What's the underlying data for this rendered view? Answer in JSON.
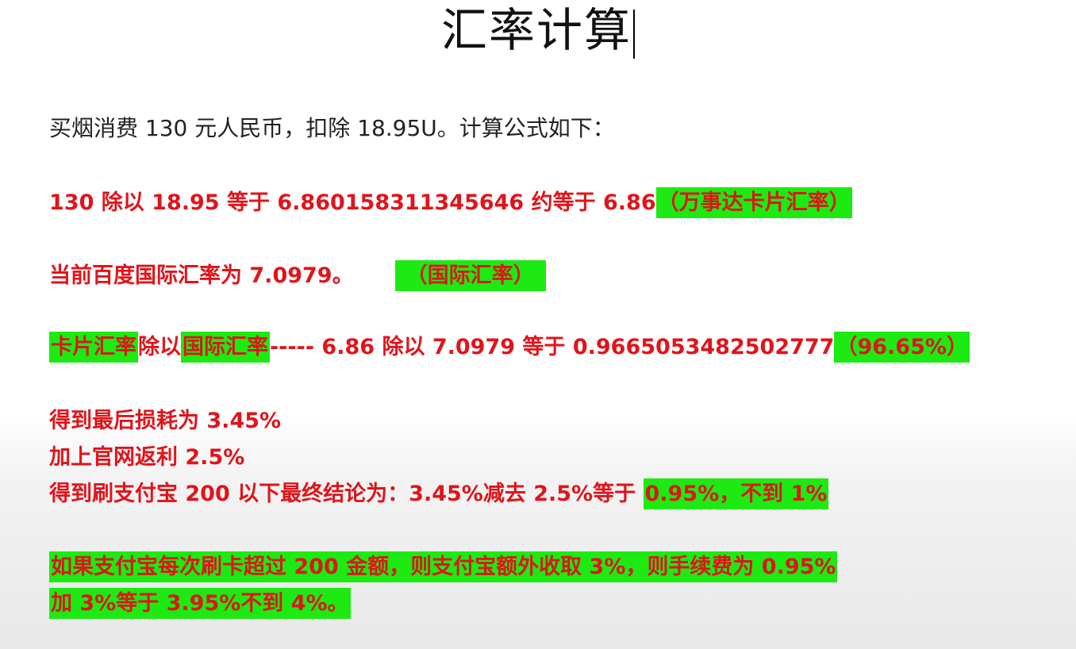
{
  "title": "汇率计算",
  "intro": "买烟消费 130 元人民币，扣除 18.95U。计算公式如下：",
  "line1": {
    "text": "130 除以 18.95 等于 6.860158311345646 约等于 6.86",
    "highlight": "（万事达卡片汇率）"
  },
  "line2": {
    "text": "当前百度国际汇率为 7.0979。",
    "highlight": "（国际汇率）"
  },
  "line3": {
    "hl1": "卡片汇率",
    "t1": "除以",
    "hl2": "国际汇率",
    "t2": "----- 6.86 除以 7.0979 等于 0.9665053482502777",
    "hl3": "（96.65%）"
  },
  "line4": "得到最后损耗为 3.45%",
  "line5": "加上官网返利 2.5%",
  "line6": {
    "text": "得到刷支付宝 200 以下最终结论为：3.45%减去 2.5%等于 ",
    "highlight": "0.95%，不到 1%"
  },
  "line7": "如果支付宝每次刷卡超过 200 金额，则支付宝额外收取 3%，则手续费为 0.95%",
  "line8": "加 3%等于 3.95%不到 4%。",
  "colors": {
    "text_red": "#e0141b",
    "highlight_green": "#1dea12",
    "text_dark": "#222222"
  }
}
